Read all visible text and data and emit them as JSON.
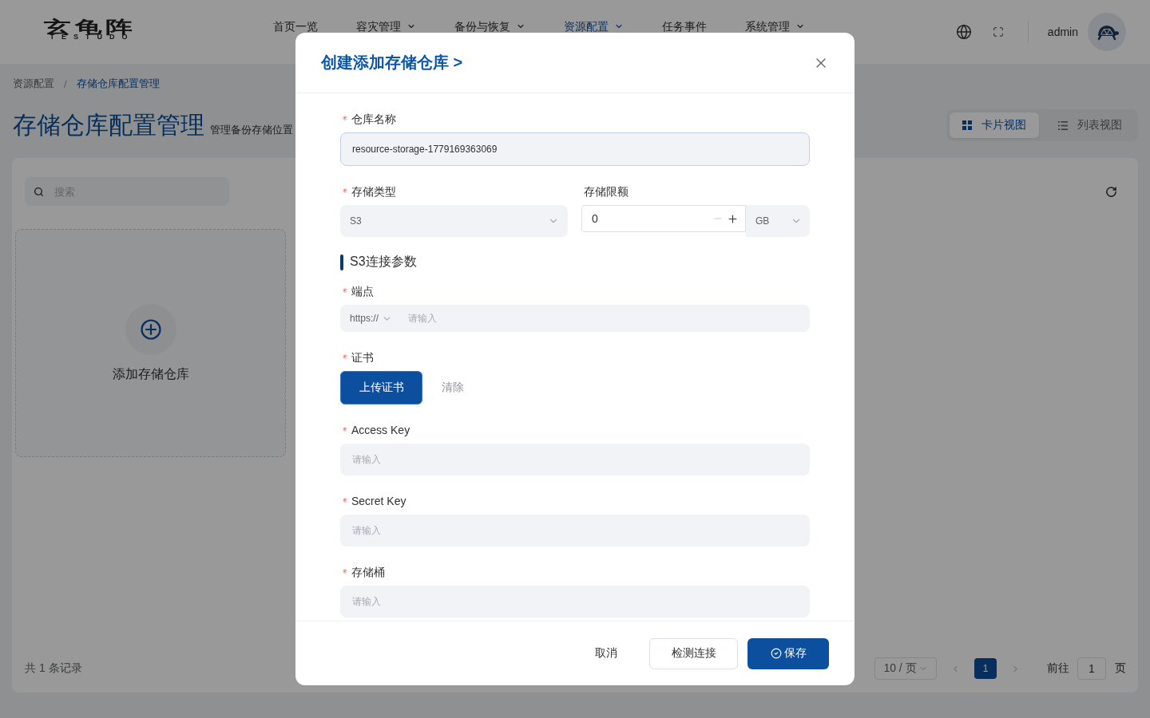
{
  "header": {
    "logo": {
      "name": "玄龟阵",
      "tagline": "TESTUDO"
    },
    "nav": [
      {
        "label": "首页一览",
        "selected": false,
        "dropdown": false
      },
      {
        "label": "容灾管理",
        "selected": false,
        "dropdown": true
      },
      {
        "label": "备份与恢复",
        "selected": false,
        "dropdown": true
      },
      {
        "label": "资源配置",
        "selected": true,
        "dropdown": true
      },
      {
        "label": "任务事件",
        "selected": false,
        "dropdown": false
      },
      {
        "label": "系统管理",
        "selected": false,
        "dropdown": true
      }
    ],
    "user": "admin"
  },
  "breadcrumb": {
    "separator": "/",
    "items": [
      {
        "label": "资源配置",
        "current": false
      },
      {
        "label": "存储仓库配置管理",
        "current": true
      }
    ]
  },
  "page": {
    "title": "存储仓库配置管理",
    "subtitle": "管理备份存储位置"
  },
  "view_toggle": [
    {
      "kind": "grid",
      "label": "卡片视图",
      "selected": true
    },
    {
      "kind": "list",
      "label": "列表视图",
      "selected": false
    }
  ],
  "search": {
    "placeholder": "搜索"
  },
  "add_card": {
    "label": "添加存储仓库"
  },
  "pagination": {
    "total": "共 1 条记录",
    "page_size": "10 / 页",
    "pages": [
      {
        "label": "1",
        "selected": true
      }
    ],
    "goto_label": "前往",
    "goto_value": "1",
    "goto_unit": "页"
  },
  "dialog": {
    "title": "创建添加存储仓库 >",
    "items": [
      {
        "kind": "input",
        "label": "仓库名称",
        "required": true,
        "value": "resource-storage-1779169363069",
        "focused": true
      },
      {
        "kind": "type_quota",
        "type": {
          "label": "存储类型",
          "required": true,
          "value": "S3"
        },
        "quota": {
          "label": "存储限额",
          "required": false,
          "value": "0",
          "unit": "GB"
        }
      },
      {
        "kind": "section",
        "title": "S3连接参数"
      },
      {
        "kind": "endpoint",
        "label": "端点",
        "required": true,
        "protocol": "https://",
        "placeholder": "请输入"
      },
      {
        "kind": "upload",
        "label": "证书",
        "required": true,
        "button": "上传证书",
        "clear": "清除"
      },
      {
        "kind": "input",
        "label": "Access Key",
        "required": true,
        "placeholder": "请输入",
        "focused": false
      },
      {
        "kind": "input",
        "label": "Secret Key",
        "required": true,
        "placeholder": "请输入",
        "focused": false
      },
      {
        "kind": "input",
        "label": "存储桶",
        "required": true,
        "placeholder": "请输入",
        "focused": false
      }
    ],
    "buttons": [
      {
        "kind": "text",
        "label": "取消"
      },
      {
        "kind": "default",
        "label": "检测连接"
      },
      {
        "kind": "primary",
        "label": "保存"
      }
    ]
  }
}
